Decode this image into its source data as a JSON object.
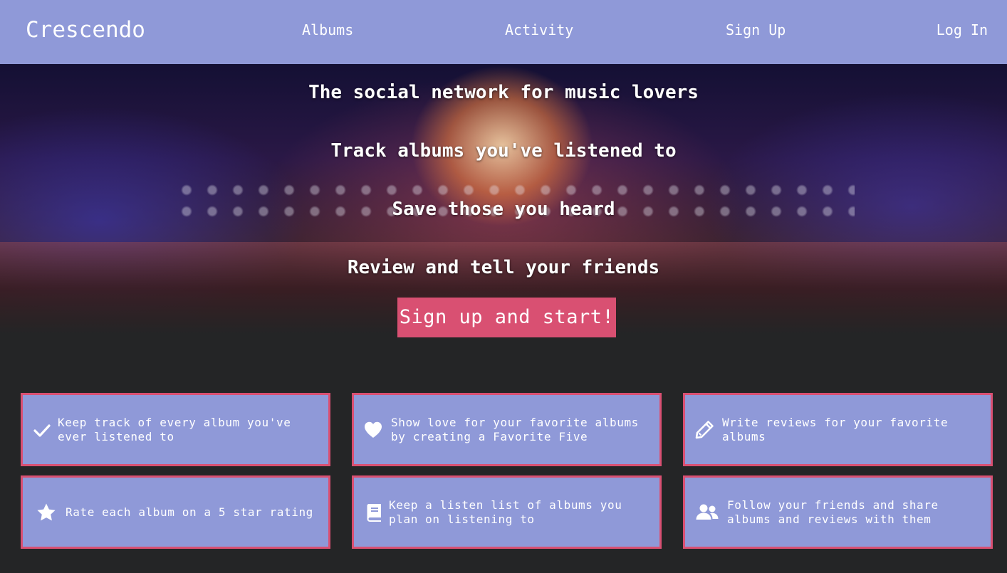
{
  "navbar": {
    "brand": "Crescendo",
    "links": {
      "albums": "Albums",
      "activity": "Activity",
      "sign_up": "Sign Up",
      "log_in": "Log In"
    }
  },
  "hero": {
    "lines": [
      "The social network for music lovers",
      "Track albums you've listened to",
      "Save those you heard",
      "Review and tell your friends"
    ],
    "cta": "Sign up and start!"
  },
  "features": [
    {
      "icon": "check-icon",
      "text": "Keep track of every album you've ever listened to"
    },
    {
      "icon": "heart-icon",
      "text": "Show love for your favorite albums by creating a Favorite Five"
    },
    {
      "icon": "pencil-icon",
      "text": "Write reviews for your favorite albums"
    },
    {
      "icon": "star-icon",
      "text": "Rate each album on a 5 star rating"
    },
    {
      "icon": "book-icon",
      "text": "Keep a listen list of albums you plan on listening to"
    },
    {
      "icon": "users-icon",
      "text": "Follow your friends and share albums and reviews with them"
    }
  ],
  "colors": {
    "navbar": "#8f99d8",
    "accent": "#d95072",
    "background": "#242526",
    "card": "#8f99d8"
  }
}
